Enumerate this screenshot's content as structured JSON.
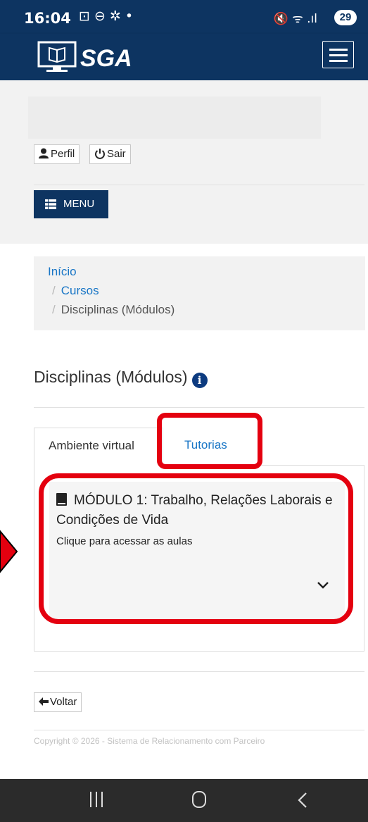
{
  "status_bar": {
    "time": "16:04",
    "left_icons": "⊡ ⊖ ✲ •",
    "right_icons": "🔇 ᯤ .ıl",
    "battery": "29"
  },
  "header": {
    "logo_text": "SGA",
    "brand_color": "#0d3461"
  },
  "user_actions": {
    "profile_label": "Perfil",
    "logout_label": "Sair"
  },
  "menu": {
    "label": "MENU"
  },
  "breadcrumb": {
    "items": [
      "Início",
      "Cursos",
      "Disciplinas (Módulos)"
    ],
    "separator": "/"
  },
  "page": {
    "title": "Disciplinas (Módulos)"
  },
  "tabs": [
    {
      "label": "Ambiente virtual",
      "active": true
    },
    {
      "label": "Tutorias",
      "active": false
    }
  ],
  "module": {
    "title": "MÓDULO 1: Trabalho, Relações Laborais e Condições de Vida",
    "subtitle": "Clique para acessar as aulas"
  },
  "footer": {
    "back_label": "Voltar",
    "copyright": "Copyright © 2026 - Sistema de Relacionamento com Parceiro"
  },
  "annotation": {
    "highlight_color": "#e4000f"
  },
  "icons": [
    "monitor-book-logo-icon",
    "hamburger-icon",
    "user-icon",
    "power-icon",
    "list-icon",
    "info-icon",
    "book-icon",
    "chevron-down-icon",
    "arrow-left-icon"
  ]
}
